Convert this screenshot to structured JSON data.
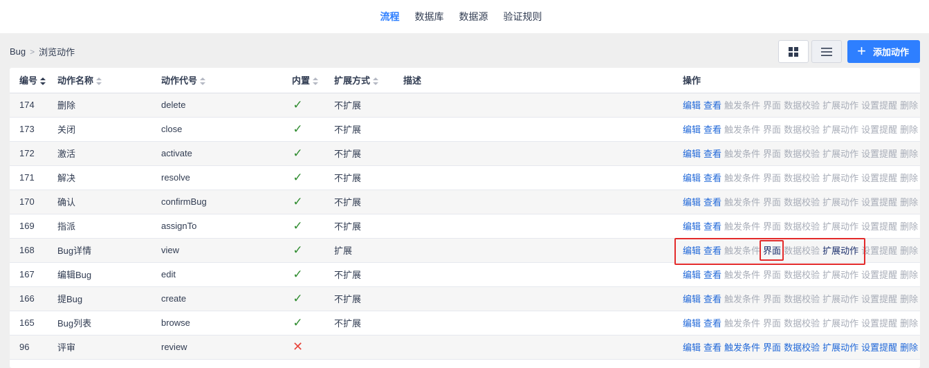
{
  "topnav": {
    "items": [
      "流程",
      "数据库",
      "数据源",
      "验证规则"
    ],
    "active_index": 0
  },
  "breadcrumb": {
    "root": "Bug",
    "sep": ">",
    "current": "浏览动作"
  },
  "toolbar": {
    "add_label": "添加动作",
    "grid_icon": "grid-view-icon",
    "list_icon": "list-view-icon"
  },
  "columns": {
    "id": "编号",
    "name": "动作名称",
    "code": "动作代号",
    "builtin": "内置",
    "extend": "扩展方式",
    "desc": "描述",
    "ops": "操作"
  },
  "action_labels": [
    "编辑",
    "查看",
    "触发条件",
    "界面",
    "数据校验",
    "扩展动作",
    "设置提醒",
    "删除"
  ],
  "rows": [
    {
      "id": "174",
      "name": "删除",
      "code": "delete",
      "builtin": true,
      "extend": "不扩展",
      "enabled": [
        true,
        true,
        false,
        false,
        false,
        false,
        false,
        false
      ],
      "bold": []
    },
    {
      "id": "173",
      "name": "关闭",
      "code": "close",
      "builtin": true,
      "extend": "不扩展",
      "enabled": [
        true,
        true,
        false,
        false,
        false,
        false,
        false,
        false
      ],
      "bold": []
    },
    {
      "id": "172",
      "name": "激活",
      "code": "activate",
      "builtin": true,
      "extend": "不扩展",
      "enabled": [
        true,
        true,
        false,
        false,
        false,
        false,
        false,
        false
      ],
      "bold": []
    },
    {
      "id": "171",
      "name": "解决",
      "code": "resolve",
      "builtin": true,
      "extend": "不扩展",
      "enabled": [
        true,
        true,
        false,
        false,
        false,
        false,
        false,
        false
      ],
      "bold": []
    },
    {
      "id": "170",
      "name": "确认",
      "code": "confirmBug",
      "builtin": true,
      "extend": "不扩展",
      "enabled": [
        true,
        true,
        false,
        false,
        false,
        false,
        false,
        false
      ],
      "bold": []
    },
    {
      "id": "169",
      "name": "指派",
      "code": "assignTo",
      "builtin": true,
      "extend": "不扩展",
      "enabled": [
        true,
        true,
        false,
        false,
        false,
        false,
        false,
        false
      ],
      "bold": []
    },
    {
      "id": "168",
      "name": "Bug详情",
      "code": "view",
      "builtin": true,
      "extend": "扩展",
      "enabled": [
        true,
        true,
        false,
        true,
        false,
        true,
        false,
        false
      ],
      "bold": [
        3,
        5
      ]
    },
    {
      "id": "167",
      "name": "编辑Bug",
      "code": "edit",
      "builtin": true,
      "extend": "不扩展",
      "enabled": [
        true,
        true,
        false,
        false,
        false,
        false,
        false,
        false
      ],
      "bold": []
    },
    {
      "id": "166",
      "name": "提Bug",
      "code": "create",
      "builtin": true,
      "extend": "不扩展",
      "enabled": [
        true,
        true,
        false,
        false,
        false,
        false,
        false,
        false
      ],
      "bold": []
    },
    {
      "id": "165",
      "name": "Bug列表",
      "code": "browse",
      "builtin": true,
      "extend": "不扩展",
      "enabled": [
        true,
        true,
        false,
        false,
        false,
        false,
        false,
        false
      ],
      "bold": []
    },
    {
      "id": "96",
      "name": "评审",
      "code": "review",
      "builtin": false,
      "extend": "",
      "enabled": [
        true,
        true,
        true,
        true,
        true,
        true,
        true,
        true
      ],
      "bold": []
    }
  ],
  "colors": {
    "accent": "#2e7fff",
    "link": "#2168d8",
    "disabled": "#a8adb8",
    "check": "#2e8b2e",
    "cross": "#e8453c",
    "highlight": "#e32a2a"
  }
}
